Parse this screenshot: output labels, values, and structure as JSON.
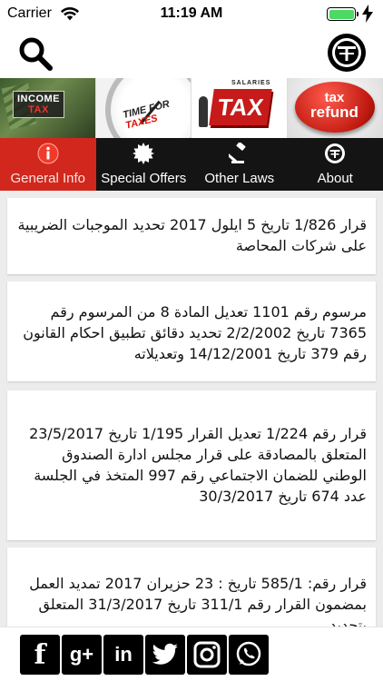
{
  "status_bar": {
    "carrier": "Carrier",
    "time": "11:19 AM"
  },
  "banner": {
    "tile1_text": "INCOME",
    "tile1_sub": "TAX",
    "tile2_text": "TIME FOR",
    "tile2_red": "TAXES",
    "tile3_small": "SALARIES",
    "tile3_big": "TAX",
    "tile4_line1": "tax",
    "tile4_line2": "refund"
  },
  "tabs": [
    {
      "label": "General Info",
      "icon": "info-icon",
      "active": true
    },
    {
      "label": "Special Offers",
      "icon": "starburst-badge-icon",
      "active": false
    },
    {
      "label": "Other Laws",
      "icon": "gavel-icon",
      "active": false
    },
    {
      "label": "About",
      "icon": "logo-icon",
      "active": false
    }
  ],
  "items": [
    {
      "text": "قرار 1/826 تاريخ 5 ايلول 2017 تحديد الموجبات الضريبية على شركات المحاصة"
    },
    {
      "text": "مرسوم رقم 1101 تعديل المادة 8 من المرسوم رقم 7365 تاريخ 2/2/2002 تحديد دقائق تطبيق احكام القانون رقم 379 تاريخ 14/12/2001 وتعديلاته"
    },
    {
      "text": "قرار رقم 1/224 تعديل القرار 1/195 تاريخ 23/5/2017 المتعلق بالمصادقة على قرار مجلس ادارة الصندوق الوطني للضمان الاجتماعي رقم 997 المتخذ في الجلسة عدد 674 تاريخ 30/3/2017"
    },
    {
      "text": "قرار رقم: 585/1 تاريخ : 23 حزيران 2017 تمديد العمل بمضمون القرار رقم 311/1 تاريخ 31/3/2017 المتعلق بتحديد"
    }
  ],
  "social": [
    {
      "name": "facebook-icon",
      "glyph": "f"
    },
    {
      "name": "google-plus-icon",
      "glyph": "g+"
    },
    {
      "name": "linkedin-icon",
      "glyph": "in"
    },
    {
      "name": "twitter-icon",
      "glyph": "🐦"
    },
    {
      "name": "instagram-icon",
      "glyph": "◎"
    },
    {
      "name": "whatsapp-icon",
      "glyph": "✆"
    }
  ],
  "colors": {
    "tab_bar_bg": "#141414",
    "tab_active_bg": "#d1271c",
    "list_bg": "#ececec"
  }
}
